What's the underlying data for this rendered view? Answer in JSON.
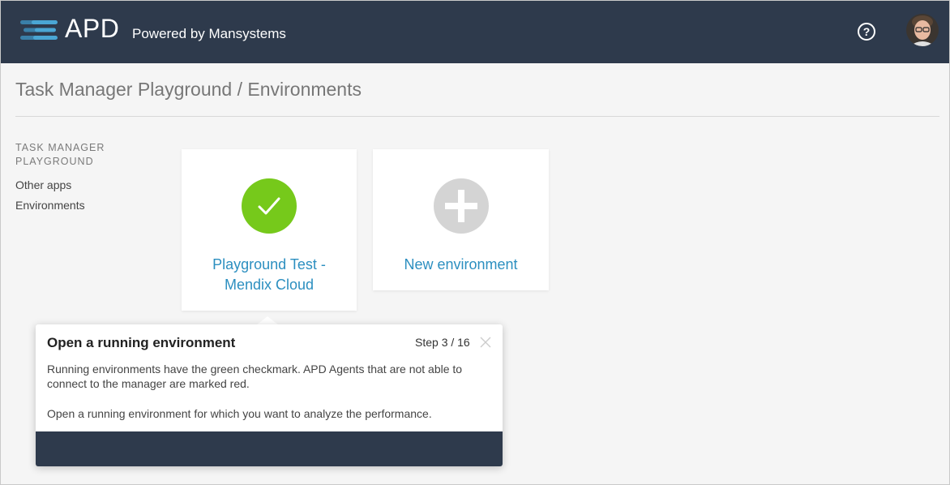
{
  "header": {
    "brand": "APD",
    "tagline": "Powered by Mansystems",
    "help_icon": "question-circle-icon",
    "help_glyph": "?",
    "avatar_icon": "user-avatar",
    "background": "#2e3a4c"
  },
  "page": {
    "title": "Task Manager Playground / Environments"
  },
  "sidebar": {
    "heading": "TASK MANAGER PLAYGROUND",
    "items": [
      {
        "label": "Other apps"
      },
      {
        "label": "Environments"
      }
    ]
  },
  "environments": [
    {
      "label_line1": "Playground Test -",
      "label_line2": "Mendix Cloud",
      "icon": "checkmark-icon",
      "status_color": "#76c91b"
    },
    {
      "label_line1": "New environment",
      "icon": "plus-icon",
      "status_color": "#d4d4d4"
    }
  ],
  "tour": {
    "title": "Open a running environment",
    "step": "Step 3 / 16",
    "close_icon": "close-icon",
    "paragraph1": "Running environments have the green checkmark. APD Agents that are not able to connect to the manager are marked red.",
    "paragraph2": "Open a running environment for which you want to analyze the performance."
  },
  "colors": {
    "accent_link": "#2c8fc0",
    "running_green": "#76c91b",
    "header_bg": "#2e3a4c"
  }
}
